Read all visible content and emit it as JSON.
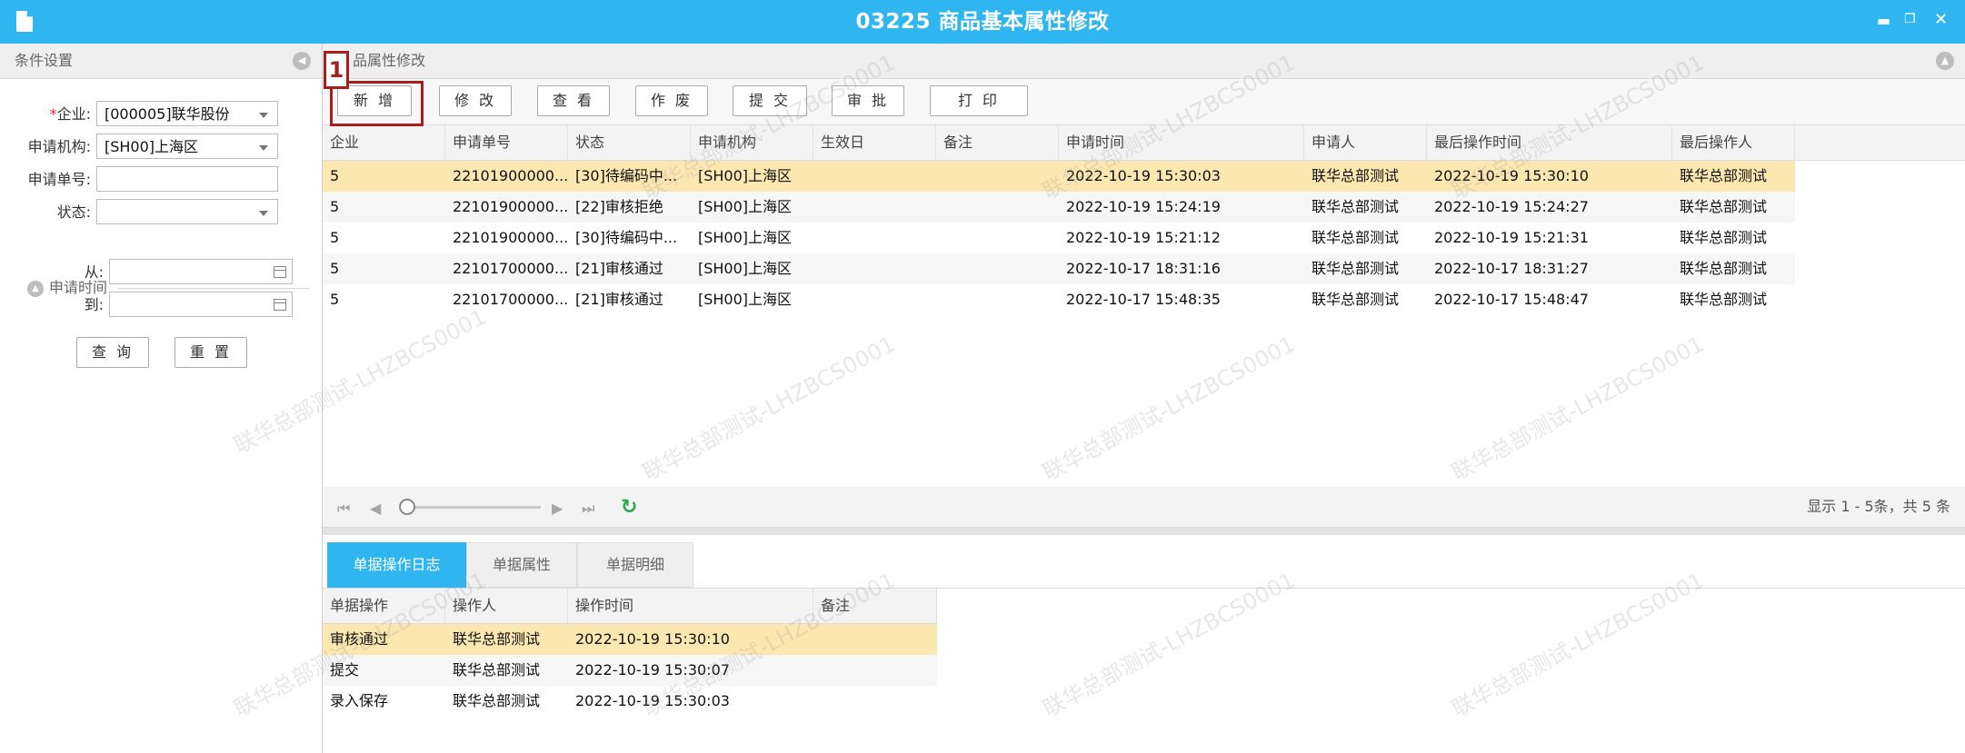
{
  "window": {
    "title": "03225 商品基本属性修改"
  },
  "left_panel": {
    "title": "条件设置",
    "fields": {
      "company": {
        "label": "企业:",
        "required_mark": "*",
        "value": "[000005]联华股份"
      },
      "org": {
        "label": "申请机构:",
        "value": "[SH00]上海区"
      },
      "apply_no": {
        "label": "申请单号:",
        "value": ""
      },
      "status": {
        "label": "状态:",
        "value": ""
      }
    },
    "time_group": {
      "label": "申请时间",
      "from_label": "从:",
      "to_label": "到:",
      "from_value": "",
      "to_value": ""
    },
    "query_btn": "查 询",
    "reset_btn": "重 置"
  },
  "main": {
    "title": "品属性修改",
    "toolbar": {
      "add": "新 增",
      "edit": "修 改",
      "view": "查 看",
      "void": "作 废",
      "submit": "提 交",
      "approve": "审 批",
      "print": "打 印"
    },
    "columns": [
      "企业",
      "申请单号",
      "状态",
      "申请机构",
      "生效日",
      "备注",
      "申请时间",
      "申请人",
      "最后操作时间",
      "最后操作人"
    ],
    "rows": [
      [
        "5",
        "22101900000...",
        "[30]待编码中...",
        "[SH00]上海区",
        "",
        "",
        "2022-10-19 15:30:03",
        "联华总部测试",
        "2022-10-19 15:30:10",
        "联华总部测试"
      ],
      [
        "5",
        "22101900000...",
        "[22]审核拒绝",
        "[SH00]上海区",
        "",
        "",
        "2022-10-19 15:24:19",
        "联华总部测试",
        "2022-10-19 15:24:27",
        "联华总部测试"
      ],
      [
        "5",
        "22101900000...",
        "[30]待编码中...",
        "[SH00]上海区",
        "",
        "",
        "2022-10-19 15:21:12",
        "联华总部测试",
        "2022-10-19 15:21:31",
        "联华总部测试"
      ],
      [
        "5",
        "22101700000...",
        "[21]审核通过",
        "[SH00]上海区",
        "",
        "",
        "2022-10-17 18:31:16",
        "联华总部测试",
        "2022-10-17 18:31:27",
        "联华总部测试"
      ],
      [
        "5",
        "22101700000...",
        "[21]审核通过",
        "[SH00]上海区",
        "",
        "",
        "2022-10-17 15:48:35",
        "联华总部测试",
        "2022-10-17 15:48:47",
        "联华总部测试"
      ]
    ],
    "pager_info": "显示 1 - 5条，共 5 条"
  },
  "bottom": {
    "tabs": [
      "单据操作日志",
      "单据属性",
      "单据明细"
    ],
    "columns": [
      "单据操作",
      "操作人",
      "操作时间",
      "备注"
    ],
    "rows": [
      [
        "审核通过",
        "联华总部测试",
        "2022-10-19 15:30:10",
        ""
      ],
      [
        "提交",
        "联华总部测试",
        "2022-10-19 15:30:07",
        ""
      ],
      [
        "录入保存",
        "联华总部测试",
        "2022-10-19 15:30:03",
        ""
      ]
    ]
  },
  "watermark": "联华总部测试-LHZBCS0001",
  "annotation": {
    "number": "1"
  },
  "colors": {
    "accent": "#2fb6f0",
    "selected_row": "#fbe7b0",
    "annotation": "#a81e1e"
  }
}
